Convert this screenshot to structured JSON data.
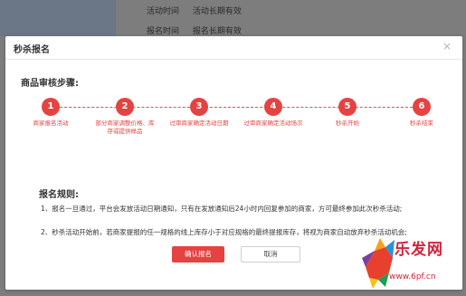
{
  "background": {
    "rows": [
      {
        "label": "活动时间",
        "value": "活动长期有效"
      },
      {
        "label": "报名时间",
        "value": "报名长期有效"
      }
    ]
  },
  "modal": {
    "title": "秒杀报名",
    "close_glyph": "×",
    "steps_title": "商品审核步骤:",
    "steps": [
      {
        "number": "1",
        "label": "商家报名活动"
      },
      {
        "number": "2",
        "label": "部分商家调整价格、库存或提供样品"
      },
      {
        "number": "3",
        "label": "过审商家确定活动日期"
      },
      {
        "number": "4",
        "label": "过审商家确定活动场次"
      },
      {
        "number": "5",
        "label": "秒杀开始"
      },
      {
        "number": "6",
        "label": "秒杀结束"
      }
    ],
    "rules_title": "报名规则:",
    "rules": [
      "1、报名一旦通过，平台会发放活动日期通知，只有在发放通知后24小时内回复参加的商家，方可最终参加此次秒杀活动;",
      "2、秒杀活动开始前，若商家提报的任一规格的线上库存小于对应规格的最终提报库存，将视为商家自动放弃秒杀活动机会;"
    ],
    "confirm_label": "确认报名",
    "cancel_label": "取消"
  },
  "watermark": {
    "text": "乐发网",
    "url": "www.6pf.cn"
  },
  "colors": {
    "accent": "#e64242",
    "watermark": "#d2233b"
  }
}
